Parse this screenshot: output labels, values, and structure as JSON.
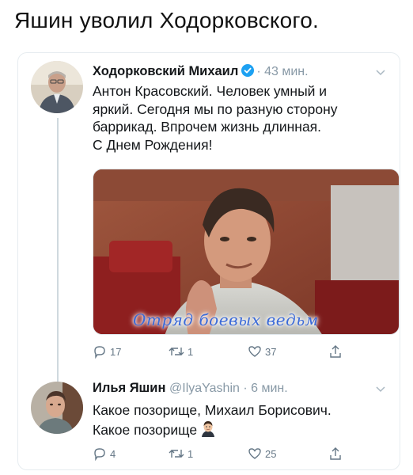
{
  "headline": "Яшин уволил Ходорковского.",
  "tweets": [
    {
      "author": "Ходорковский Михаил",
      "meta": "· 43 мин.",
      "text_lines": [
        "Антон Красовский. Человек умный и",
        "яркий. Сегодня мы по разную сторону",
        "баррикад. Впрочем жизнь длинная.",
        "С Днем Рождения!"
      ],
      "media_watermark": "Отряд боевых ведьм",
      "replies": "17",
      "retweets": "1",
      "likes": "37"
    },
    {
      "author": "Илья Яшин",
      "meta": "@IlyaYashin · 6 мин.",
      "text_lines": [
        "Какое позорище, Михаил Борисович.",
        "Какое позорище"
      ],
      "replies": "4",
      "retweets": "1",
      "likes": "25"
    }
  ],
  "colors": {
    "verified": "#1da1f2",
    "meta_gray": "#8899a6",
    "watermark_blue": "#3b6ad8"
  },
  "icons": [
    "verified-badge-icon",
    "chevron-down-icon",
    "reply-icon",
    "retweet-icon",
    "like-icon",
    "share-icon",
    "man-emoji-icon"
  ]
}
